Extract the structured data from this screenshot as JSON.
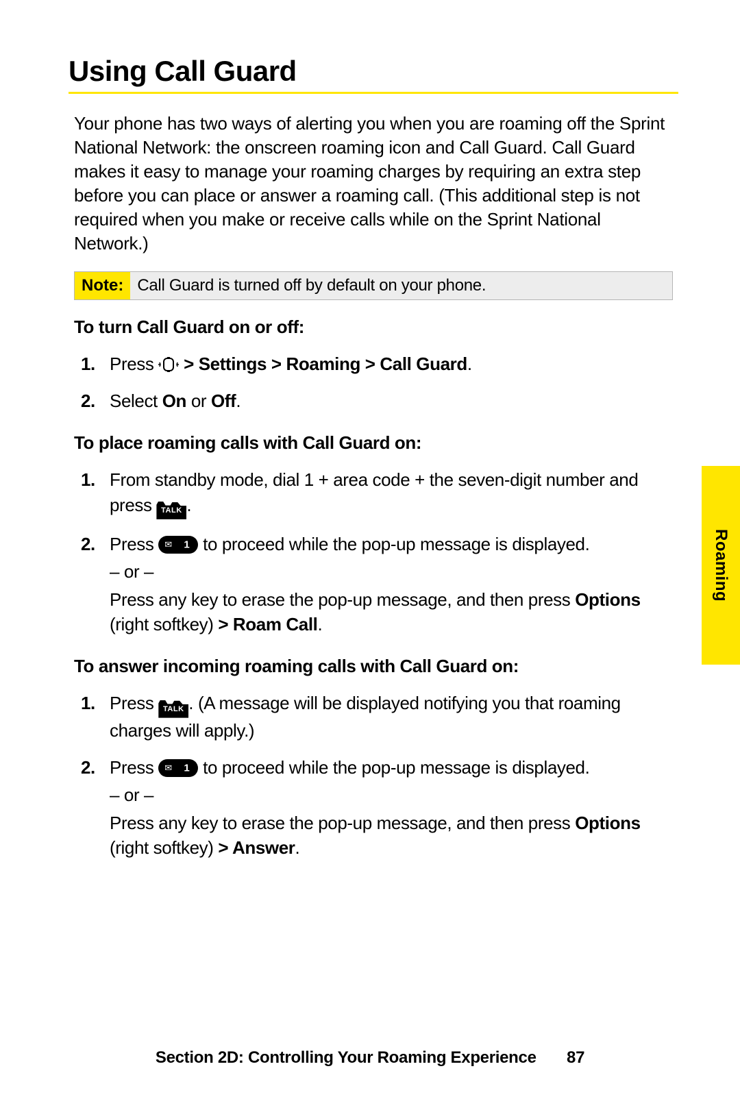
{
  "title": "Using Call Guard",
  "intro": "Your phone has two ways of alerting you when you are roaming off the Sprint National Network: the onscreen roaming icon and Call Guard. Call Guard makes it easy to manage your roaming charges by requiring an extra step before you can place or answer a roaming call. (This additional step is not required when you make or receive calls while on the Sprint National Network.)",
  "note_label": "Note:",
  "note_text": "Call Guard is turned off by default on your phone.",
  "h_turn": "To turn Call Guard on or off:",
  "turn_1a": "Press ",
  "turn_1b": " > Settings > Roaming > Call Guard",
  "turn_1c": ".",
  "turn_2a": "Select ",
  "turn_2_on": "On",
  "turn_2_or": " or ",
  "turn_2_off": "Off",
  "turn_2_end": ".",
  "h_place": "To place roaming calls with Call Guard on:",
  "place_1a": "From standby mode, dial 1 + area code + the seven-digit number and press ",
  "place_1b": ".",
  "place_2a": "Press ",
  "place_2b": " to proceed while the pop-up message is displayed.",
  "or_text": "– or –",
  "place_2c": "Press any key to erase the pop-up message, and then press ",
  "options": "Options",
  "place_2d": " (right softkey) ",
  "roam_call": "> Roam Call",
  "period": ".",
  "h_answer": "To answer incoming roaming calls with Call Guard on:",
  "ans_1a": "Press ",
  "ans_1b": ". (A message will be displayed notifying you that roaming charges will apply.)",
  "ans_2a": "Press ",
  "ans_2b": " to proceed while the pop-up message is displayed.",
  "ans_2c": "Press any key to erase the pop-up message, and then press ",
  "answer_bold": "> Answer",
  "side_tab": "Roaming",
  "footer_section": "Section 2D: Controlling Your Roaming Experience",
  "footer_page": "87",
  "talk_label": "TALK",
  "num1": "1.",
  "num2": "2."
}
